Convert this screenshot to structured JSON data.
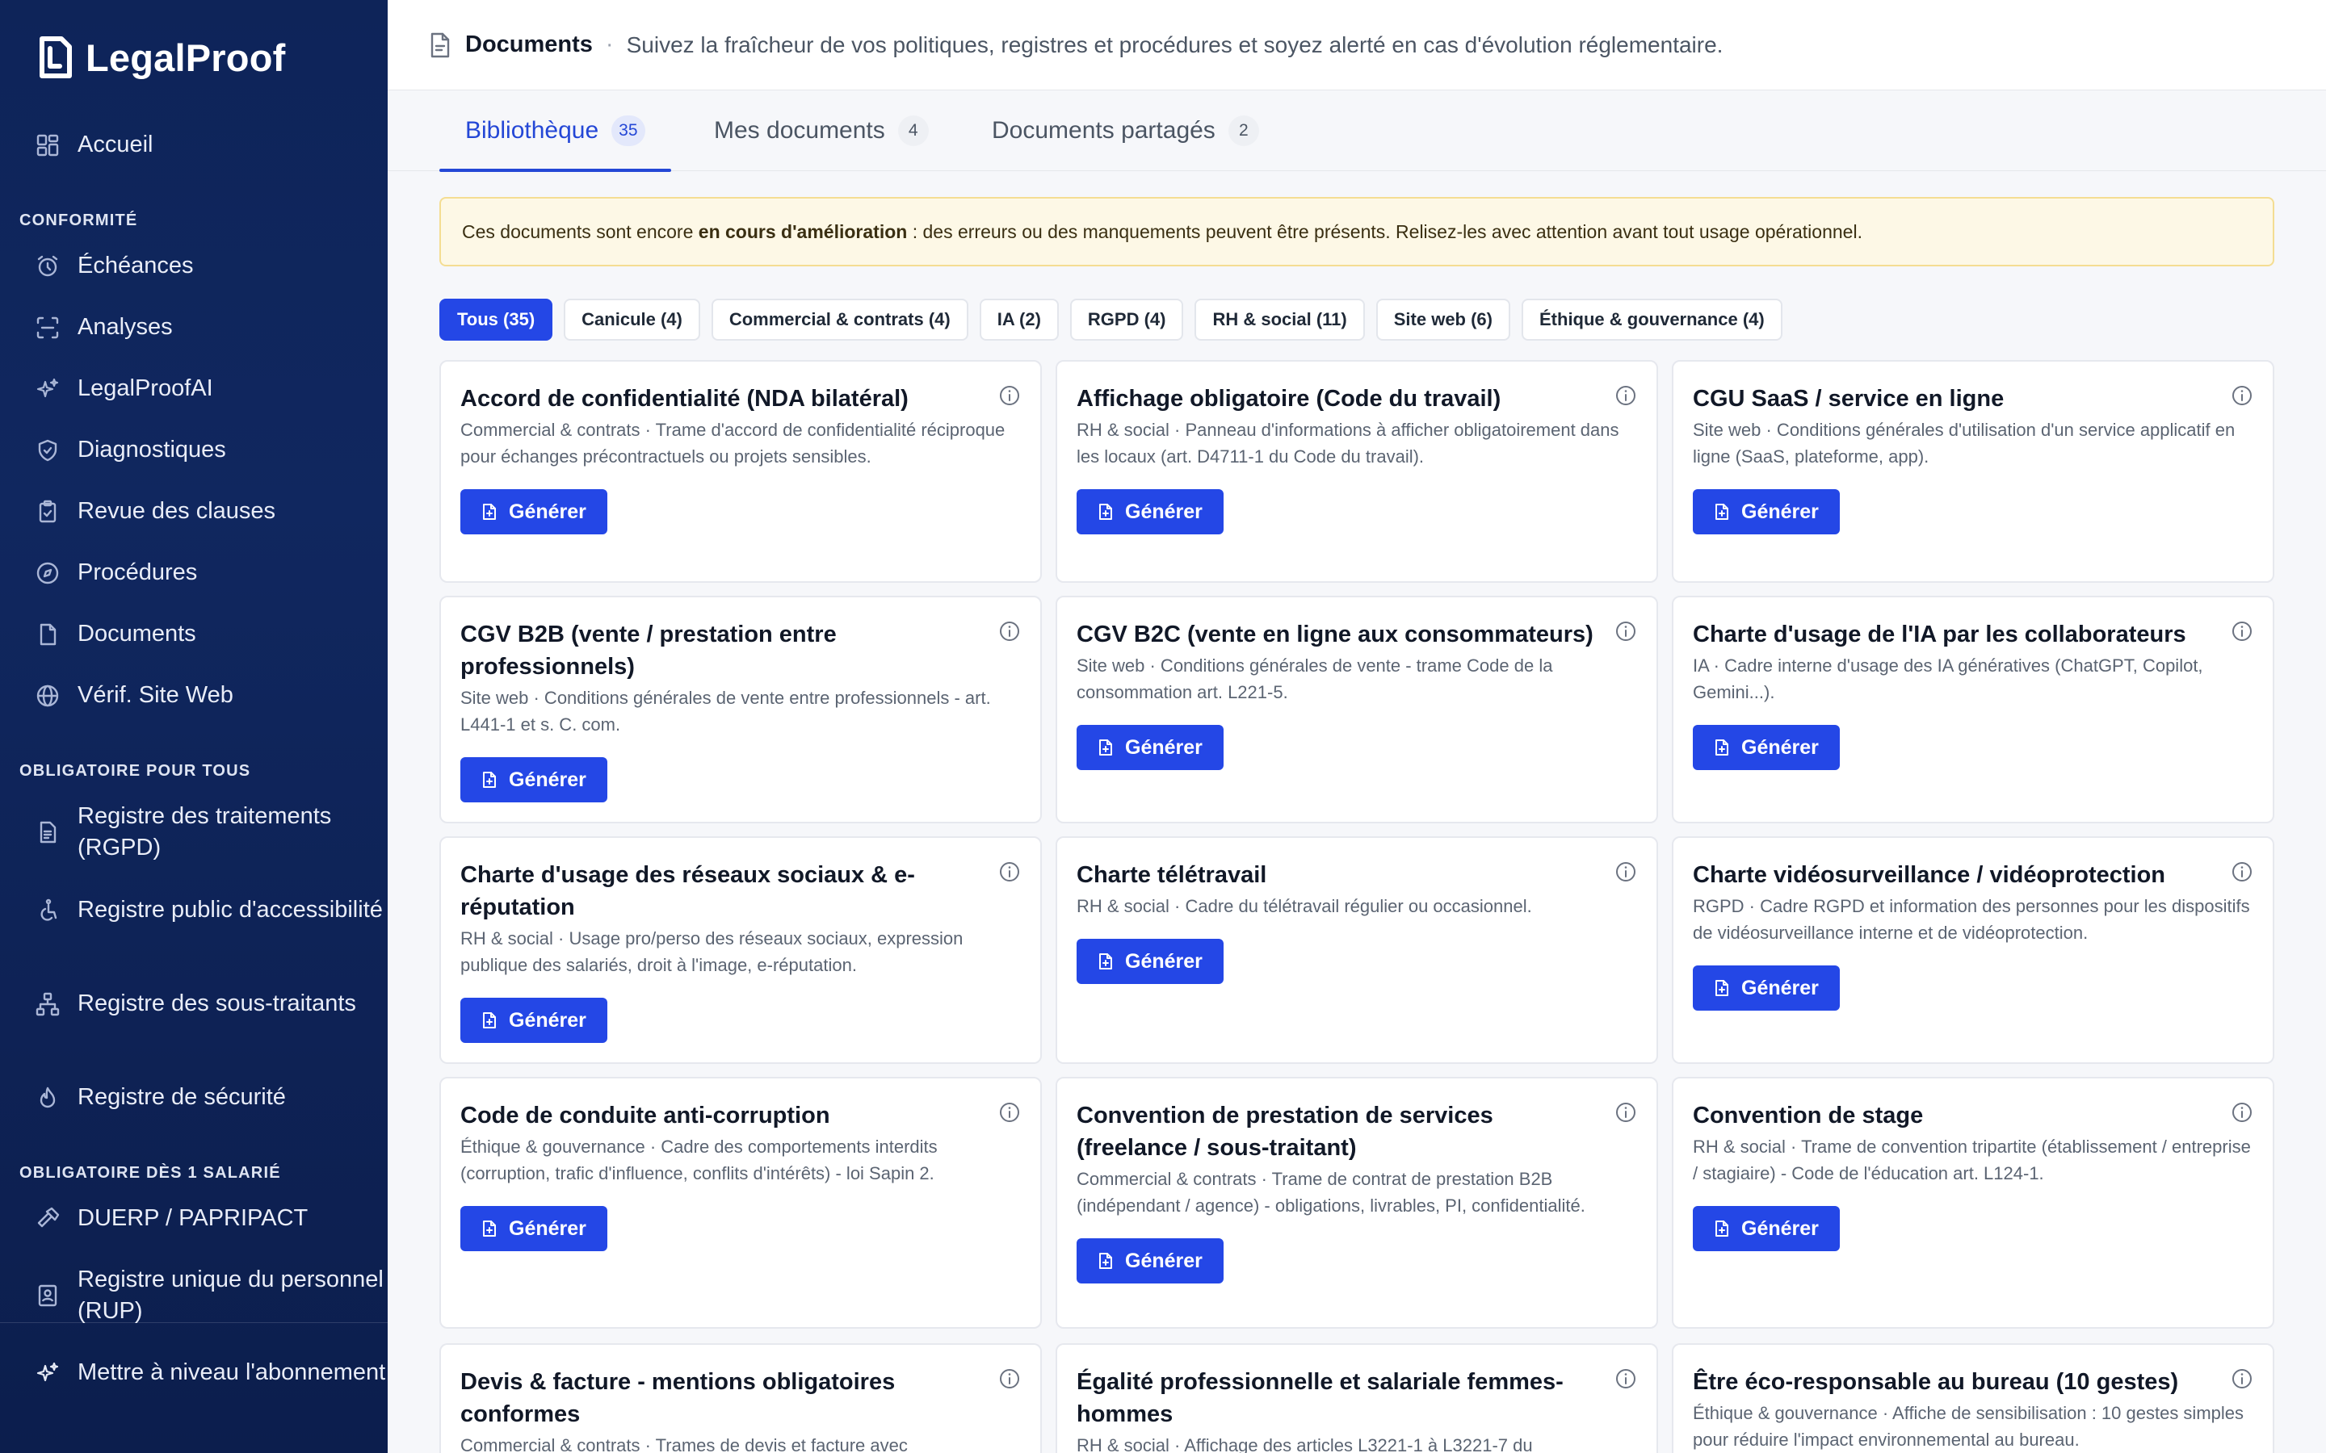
{
  "app": {
    "name": "LegalProof"
  },
  "sidebar": {
    "home": "Accueil",
    "sections": [
      {
        "title": "CONFORMITÉ",
        "items": [
          "Échéances",
          "Analyses",
          "LegalProofAI",
          "Diagnostiques",
          "Revue des clauses",
          "Procédures",
          "Documents",
          "Vérif. Site Web"
        ]
      },
      {
        "title": "OBLIGATOIRE POUR TOUS",
        "items": [
          "Registre des traitements (RGPD)",
          "Registre public d'accessibilité",
          "Registre des sous-traitants",
          "Registre de sécurité"
        ]
      },
      {
        "title": "OBLIGATOIRE DÈS 1 SALARIÉ",
        "items": [
          "DUERP / PAPRIPACT",
          "Registre unique du personnel (RUP)"
        ]
      }
    ],
    "upgrade": "Mettre à niveau l'abonnement"
  },
  "header": {
    "title": "Documents",
    "separator": "·",
    "subtitle": "Suivez la fraîcheur de vos politiques, registres et procédures et soyez alerté en cas d'évolution réglementaire."
  },
  "tabs": [
    {
      "label": "Bibliothèque",
      "count": "35"
    },
    {
      "label": "Mes documents",
      "count": "4"
    },
    {
      "label": "Documents partagés",
      "count": "2"
    }
  ],
  "notice": {
    "before": "Ces documents sont encore ",
    "bold": "en cours d'amélioration",
    "after": " : des erreurs ou des manquements peuvent être présents. Relisez-les avec attention avant tout usage opérationnel."
  },
  "filters": [
    "Tous (35)",
    "Canicule (4)",
    "Commercial & contrats (4)",
    "IA (2)",
    "RGPD (4)",
    "RH & social (11)",
    "Site web (6)",
    "Éthique & gouvernance (4)"
  ],
  "generate_label": "Générer",
  "documents": [
    {
      "title": "Accord de confidentialité (NDA bilatéral)",
      "desc": "Commercial & contrats · Trame d'accord de confidentialité réciproque pour échanges précontractuels ou projets sensibles."
    },
    {
      "title": "Affichage obligatoire (Code du travail)",
      "desc": "RH & social · Panneau d'informations à afficher obligatoirement dans les locaux (art. D4711-1 du Code du travail)."
    },
    {
      "title": "CGU SaaS / service en ligne",
      "desc": "Site web · Conditions générales d'utilisation d'un service applicatif en ligne (SaaS, plateforme, app)."
    },
    {
      "title": "CGV B2B (vente / prestation entre professionnels)",
      "desc": "Site web · Conditions générales de vente entre professionnels - art. L441-1 et s. C. com."
    },
    {
      "title": "CGV B2C (vente en ligne aux consommateurs)",
      "desc": "Site web · Conditions générales de vente - trame Code de la consommation art. L221-5."
    },
    {
      "title": "Charte d'usage de l'IA par les collaborateurs",
      "desc": "IA · Cadre interne d'usage des IA génératives (ChatGPT, Copilot, Gemini...)."
    },
    {
      "title": "Charte d'usage des réseaux sociaux & e-réputation",
      "desc": "RH & social · Usage pro/perso des réseaux sociaux, expression publique des salariés, droit à l'image, e-réputation."
    },
    {
      "title": "Charte télétravail",
      "desc": "RH & social · Cadre du télétravail régulier ou occasionnel."
    },
    {
      "title": "Charte vidéosurveillance / vidéoprotection",
      "desc": "RGPD · Cadre RGPD et information des personnes pour les dispositifs de vidéosurveillance interne et de vidéoprotection."
    },
    {
      "title": "Code de conduite anti-corruption",
      "desc": "Éthique & gouvernance · Cadre des comportements interdits (corruption, trafic d'influence, conflits d'intérêts) - loi Sapin 2."
    },
    {
      "title": "Convention de prestation de services (freelance / sous-traitant)",
      "desc": "Commercial & contrats · Trame de contrat de prestation B2B (indépendant / agence) - obligations, livrables, PI, confidentialité."
    },
    {
      "title": "Convention de stage",
      "desc": "RH & social · Trame de convention tripartite (établissement / entreprise / stagiaire) - Code de l'éducation art. L124-1."
    },
    {
      "title": "Devis & facture - mentions obligatoires conformes",
      "desc": "Commercial & contrats · Trames de devis et facture avec"
    },
    {
      "title": "Égalité professionnelle et salariale femmes-hommes",
      "desc": "RH & social · Affichage des articles L3221-1 à L3221-7 du"
    },
    {
      "title": "Être éco-responsable au bureau (10 gestes)",
      "desc": "Éthique & gouvernance · Affiche de sensibilisation : 10 gestes simples pour réduire l'impact environnemental au bureau."
    }
  ]
}
